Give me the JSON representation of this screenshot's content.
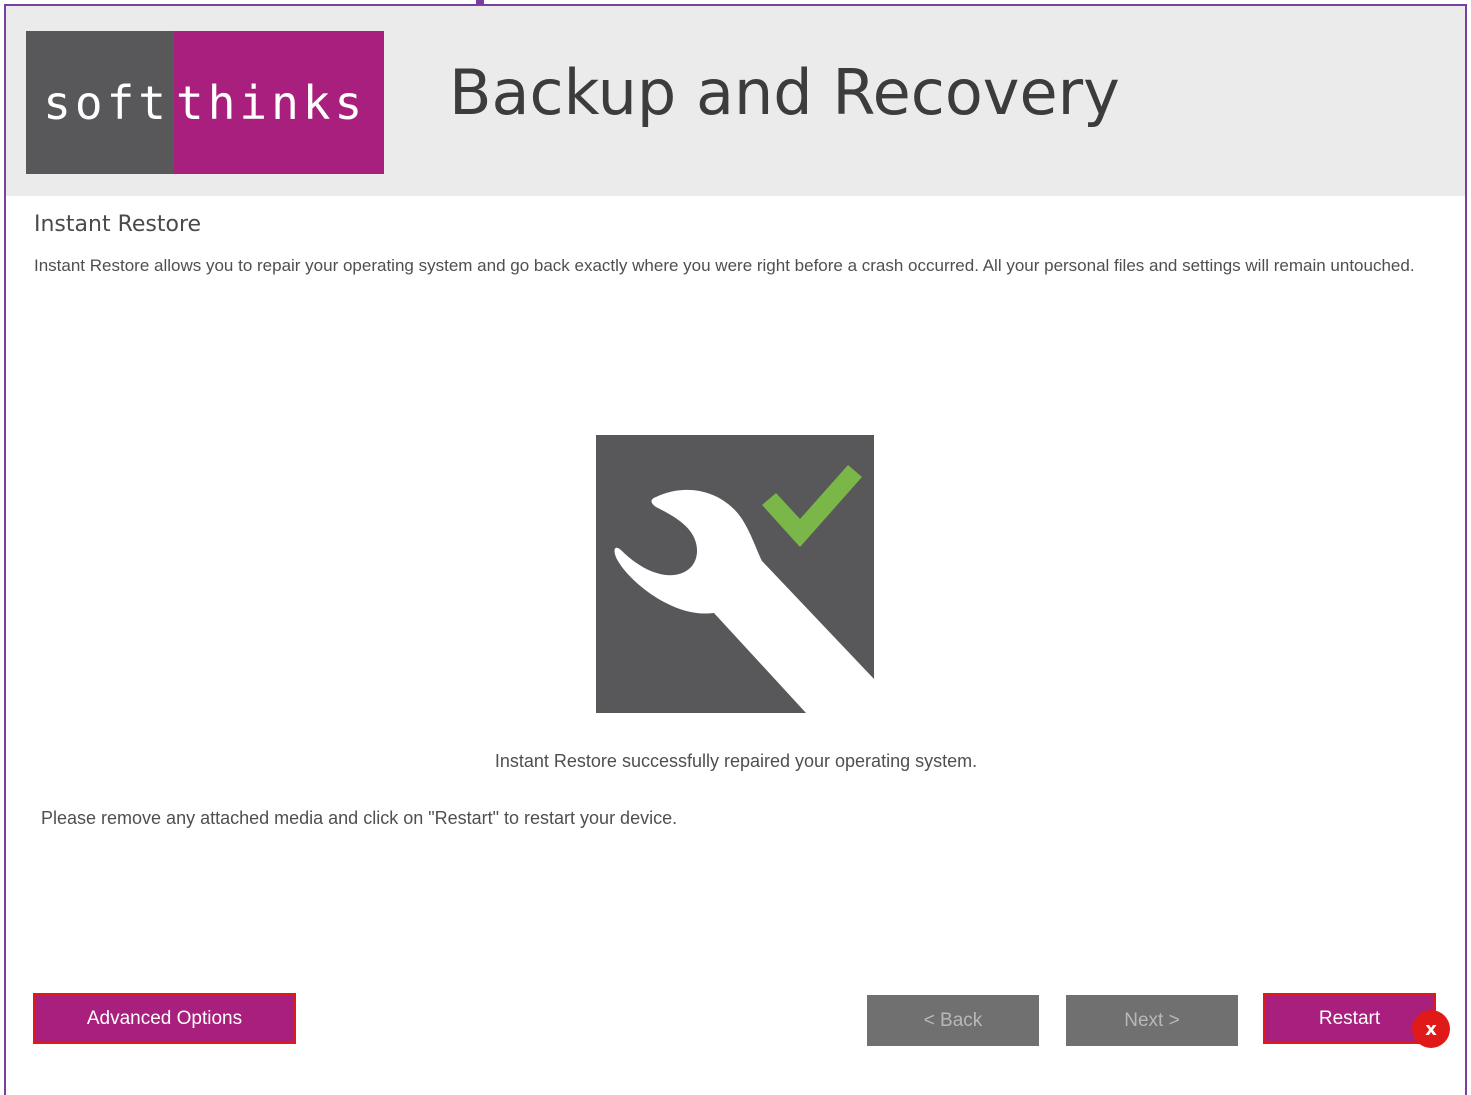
{
  "header": {
    "logo_left": "soft",
    "logo_right": "thinks",
    "app_title": "Backup and Recovery"
  },
  "section": {
    "title": "Instant Restore",
    "description": "Instant Restore allows you to repair your operating system and go back exactly where you were right before a crash occurred. All your personal files and settings will remain untouched."
  },
  "status": {
    "message": "Instant Restore successfully repaired your operating system.",
    "instruction": "Please remove any attached media and click on \"Restart\" to restart your device."
  },
  "buttons": {
    "advanced_label": "Advanced Options",
    "back_label": "< Back",
    "next_label": "Next >",
    "restart_label": "Restart"
  },
  "badge": {
    "label": "x"
  },
  "colors": {
    "brand_purple": "#a81f7e",
    "logo_gray": "#58585a",
    "header_bg": "#ebebeb",
    "check_green": "#7ab648",
    "highlight_red": "#e01919",
    "window_border": "#7a3f9d"
  },
  "icons": {
    "hero": "wrench-check-icon"
  }
}
